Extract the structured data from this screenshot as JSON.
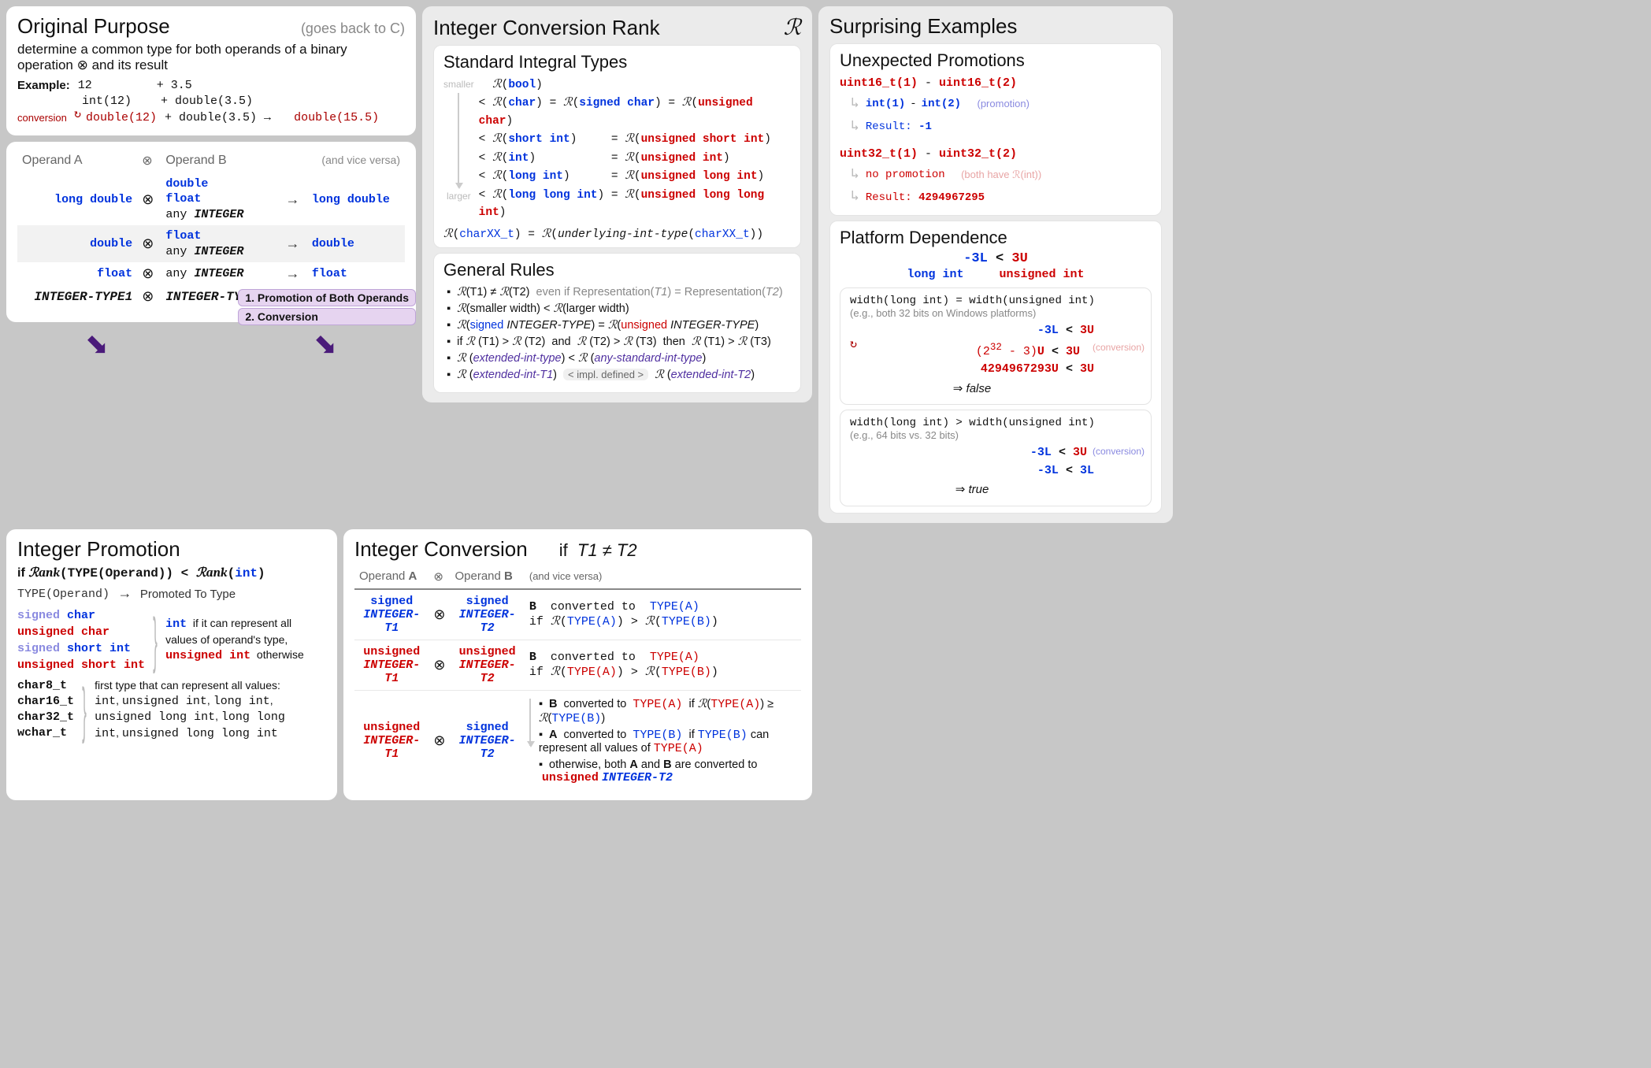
{
  "purpose": {
    "title": "Original Purpose",
    "note": "(goes back to C)",
    "desc": "determine a common type for both operands of a binary operation ⊗ and its result",
    "example_label": "Example:",
    "line1a": "12",
    "line1b": "+ 3.5",
    "line2a": "int(12)",
    "line2b": "+ double(3.5)",
    "conversion_label": "conversion",
    "line3a": "double(12)",
    "line3b": "+ double(3.5) →",
    "line3c": "double(15.5)"
  },
  "operand_table": {
    "headA": "Operand A",
    "headB": "Operand B",
    "headNote": "(and vice versa)",
    "rows": [
      {
        "a": "long double",
        "b_html": [
          "double",
          "float",
          "any INTEGER"
        ],
        "r": "long double"
      },
      {
        "a": "double",
        "b_html": [
          "float",
          "any INTEGER"
        ],
        "r": "double"
      },
      {
        "a": "float",
        "b_html": [
          "any INTEGER"
        ],
        "r": "float"
      }
    ],
    "intA": "INTEGER-TYPE1",
    "intB": "INTEGER-TYPE2",
    "step1": "1. Promotion of Both Operands",
    "step2": "2. Conversion"
  },
  "promotion": {
    "title": "Integer Promotion",
    "cond_pre": "if ",
    "cond_rank": "Rank",
    "cond_mid": "(TYPE(Operand)) < ",
    "cond_rank2": "Rank",
    "cond_post": "(",
    "cond_int": "int",
    "cond_close": ")",
    "col_left": "TYPE(Operand)",
    "col_right": "Promoted To Type",
    "types_top": [
      "signed char",
      "unsigned char",
      "signed short int",
      "unsigned short int"
    ],
    "types_bottom": [
      "char8_t",
      "char16_t",
      "char32_t",
      "wchar_t"
    ],
    "promote_top": "int  if it can represent all values of operand's type,",
    "promote_top2": "unsigned int  otherwise",
    "promote_bottom": "first type that can represent all values: int, unsigned int, long int, unsigned long int, long long int, unsigned long long int"
  },
  "rank": {
    "title": "Integer Conversion Rank",
    "rank_symbol": "ℛ",
    "std_title": "Standard Integral Types",
    "smaller": "smaller",
    "larger": "larger",
    "lines": [
      "ℛ(bool)",
      "< ℛ(char) = ℛ(signed char) = ℛ(unsigned char)",
      "< ℛ(short int)       = ℛ(unsigned short int)",
      "< ℛ(int)             = ℛ(unsigned int)",
      "< ℛ(long int)        = ℛ(unsigned long int)",
      "< ℛ(long long int)  = ℛ(unsigned long long int)"
    ],
    "charxx_pre": "ℛ(",
    "charxx_t": "charXX_t",
    "charxx_mid": ") = ℛ( underlying-int-type(",
    "charxx_post": "))",
    "rules_title": "General Rules",
    "rules": [
      {
        "text": "ℛ(T1) ≠ ℛ(T2)",
        "gray": "even if Representation(T1) = Representation(T2)"
      },
      {
        "text": "ℛ(smaller width) < ℛ(larger width)"
      },
      {
        "text": "ℛ(signed INTEGER-TYPE) = ℛ(unsigned INTEGER-TYPE)",
        "signed": true
      },
      {
        "text": "if ℛ (T1) > ℛ (T2)  and  ℛ (T2) > ℛ (T3)  then  ℛ (T1) > ℛ (T3)"
      },
      {
        "text": "ℛ (extended-int-type) < ℛ (any-standard-int-type)",
        "purple": true
      },
      {
        "text": "ℛ (extended-int-T1)",
        "pill": "< impl. defined >",
        "text2": "ℛ (extended-int-T2)",
        "purple": true
      }
    ]
  },
  "conversion": {
    "title": "Integer Conversion",
    "cond": "if  T1 ≠ T2",
    "headA": "Operand A",
    "headB": "Operand B",
    "headNote": "(and vice versa)",
    "rows": [
      {
        "at": "signed",
        "a": "INTEGER-T1",
        "bt": "signed",
        "b": "INTEGER-T2",
        "line1": "B  converted to  TYPE(A)",
        "line2": "if ℛ(TYPE(A)) > ℛ(TYPE(B))",
        "col": "blue"
      },
      {
        "at": "unsigned",
        "a": "INTEGER-T1",
        "bt": "unsigned",
        "b": "INTEGER-T2",
        "line1": "B  converted to  TYPE(A)",
        "line2": "if ℛ(TYPE(A)) > ℛ(TYPE(B))",
        "col": "red"
      }
    ],
    "mixed_at": "unsigned",
    "mixed_a": "INTEGER-T1",
    "mixed_bt": "signed",
    "mixed_b": "INTEGER-T2",
    "bullets": [
      "B  converted to  TYPE(A)  if ℛ(TYPE(A)) ≥ ℛ(TYPE(B))",
      "A  converted to  TYPE(B)  if TYPE(B) can represent all values of TYPE(A)",
      "otherwise, both A and B are converted to  unsigned INTEGER-T2"
    ]
  },
  "examples": {
    "title": "Surprising Examples",
    "promo_title": "Unexpected Promotions",
    "ex1_a": "uint16_t(1)",
    "ex1_op": " - ",
    "ex1_b": "uint16_t(2)",
    "ex1_sub1a": "int(1)",
    "ex1_sub1b": " - ",
    "ex1_sub1c": "int(2)",
    "ex1_sub1note": "(promotion)",
    "ex1_res_label": "Result: ",
    "ex1_res": "-1",
    "ex2_a": "uint32_t(1)",
    "ex2_b": "uint32_t(2)",
    "ex2_note": "no promotion",
    "ex2_note_gray": "(both have ℛ(int))",
    "ex2_res": "4294967295",
    "platform_title": "Platform Dependence",
    "pd_top": "-3L < 3U",
    "pd_top_a": "long int",
    "pd_top_b": "unsigned int",
    "case1_title": "width(long int) = width(unsigned int)",
    "case1_sub": "(e.g., both 32 bits on Windows platforms)",
    "case1_l1": "-3L < 3U",
    "case1_l2": "(2³² - 3)U < 3U",
    "case1_note": "(conversion)",
    "case1_l3": "4294967293U < 3U",
    "case1_res": "⇒ false",
    "case2_title": "width(long int) > width(unsigned int)",
    "case2_sub": "(e.g., 64 bits  vs.  32 bits)",
    "case2_l1": "-3L < 3U",
    "case2_note": "(conversion)",
    "case2_l2": "-3L < 3L",
    "case2_res": "⇒ true"
  }
}
